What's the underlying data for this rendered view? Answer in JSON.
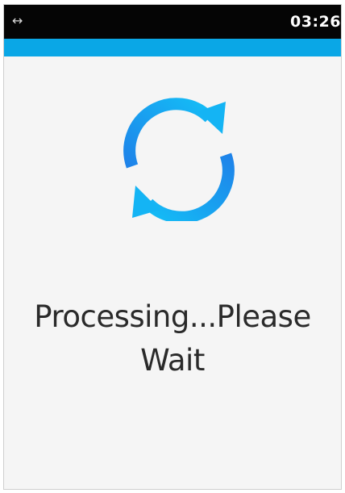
{
  "status_bar": {
    "connection_icon": "left-right-arrows-icon",
    "time": "03:26"
  },
  "colors": {
    "accent": "#0aa7e6",
    "status_bar_bg": "#050505",
    "background": "#f5f5f5"
  },
  "processing": {
    "icon": "refresh-spinner-icon",
    "message": "Processing...Please Wait"
  }
}
